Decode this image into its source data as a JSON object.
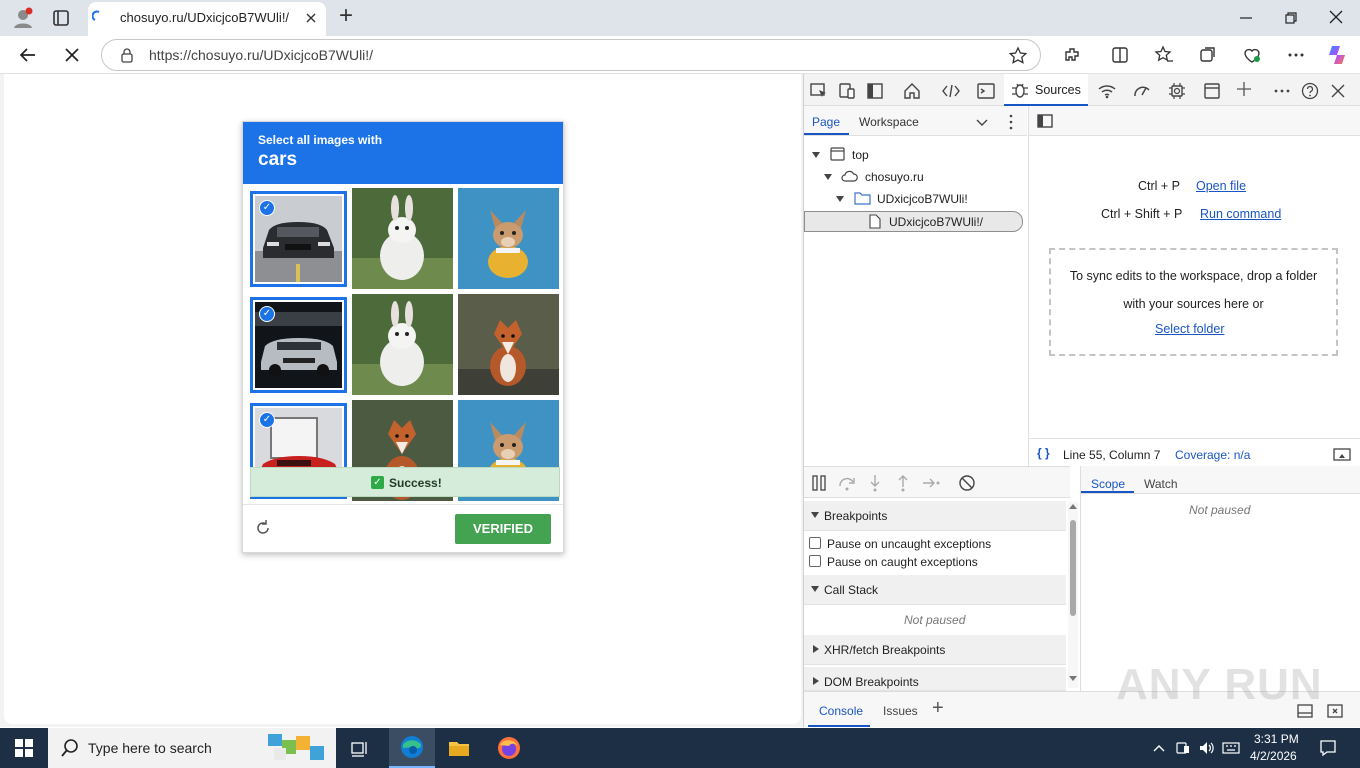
{
  "browser": {
    "tab_title": "chosuyo.ru/UDxicjcoB7WUli!/",
    "url": "https://chosuyo.ru/UDxicjcoB7WUli!/",
    "new_tab_symbol": "+"
  },
  "captcha": {
    "prompt": "Select all images with",
    "keyword": "cars",
    "tiles": [
      {
        "name": "car-1",
        "selected": true
      },
      {
        "name": "rabbit-1",
        "selected": false
      },
      {
        "name": "dog-1",
        "selected": false
      },
      {
        "name": "car-2",
        "selected": true
      },
      {
        "name": "rabbit-2",
        "selected": false
      },
      {
        "name": "fox-1",
        "selected": false
      },
      {
        "name": "car-3",
        "selected": true
      },
      {
        "name": "fox-2",
        "selected": false
      },
      {
        "name": "dog-2",
        "selected": false
      }
    ],
    "success_text": "Success!",
    "verify_label": "VERIFIED"
  },
  "devtools": {
    "active_panel": "Sources",
    "nav_tabs": [
      "Page",
      "Workspace"
    ],
    "tree": {
      "top": "top",
      "domain": "chosuyo.ru",
      "folder": "UDxicjcoB7WUli!",
      "file": "UDxicjcoB7WUli!/"
    },
    "shortcuts": [
      {
        "keys": "Ctrl + P",
        "action": "Open file"
      },
      {
        "keys": "Ctrl + Shift + P",
        "action": "Run command"
      }
    ],
    "workspace_hint": "To sync edits to the workspace, drop a folder with your sources here or",
    "select_folder": "Select folder",
    "status": {
      "braces": "{ }",
      "position": "Line 55, Column 7",
      "coverage": "Coverage: n/a"
    },
    "debugger": {
      "breakpoints": "Breakpoints",
      "pause_uncaught": "Pause on uncaught exceptions",
      "pause_caught": "Pause on caught exceptions",
      "call_stack": "Call Stack",
      "not_paused": "Not paused",
      "xhr": "XHR/fetch Breakpoints",
      "dom": "DOM Breakpoints"
    },
    "scope_tabs": [
      "Scope",
      "Watch"
    ],
    "scope_not_paused": "Not paused",
    "drawer_tabs": [
      "Console",
      "Issues"
    ],
    "drawer_add": "+"
  },
  "watermark": "ANY RUN",
  "taskbar": {
    "search_placeholder": "Type here to search",
    "time": "3:31 PM",
    "date": "4/2/2026"
  }
}
